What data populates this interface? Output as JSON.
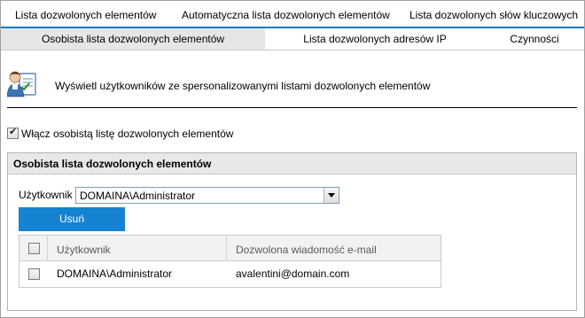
{
  "tabs_primary": [
    {
      "label": "Lista dozwolonych elementów"
    },
    {
      "label": "Automatyczna lista dozwolonych elementów"
    },
    {
      "label": "Lista dozwolonych słów kluczowych"
    }
  ],
  "tabs_secondary": [
    {
      "label": "Osobista lista dozwolonych elementów",
      "active": true
    },
    {
      "label": "Lista dozwolonych adresów IP",
      "active": false
    },
    {
      "label": "Czynności",
      "active": false
    }
  ],
  "intro": {
    "icon": "user-list-icon",
    "text": "Wyświetl użytkowników ze spersonalizowanymi listami dozwolonych elementów"
  },
  "enable": {
    "label": "Włącz osobistą listę dozwolonych elementów",
    "checked": true
  },
  "panel": {
    "title": "Osobista lista dozwolonych elementów",
    "user_label": "Użytkownik",
    "user_selected": "DOMAINA\\Administrator",
    "remove_button": "Usuń",
    "table": {
      "headers": [
        "Użytkownik",
        "Dozwolona wiadomość e-mail"
      ],
      "rows": [
        {
          "checked": false,
          "user": "DOMAINA\\Administrator",
          "email": "avalentini@domain.com"
        }
      ]
    }
  },
  "colors": {
    "accent": "#0a7cc3",
    "button": "#1583d1",
    "active_tab": "#e6e6e6",
    "panel_header": "#e8e8e8"
  }
}
